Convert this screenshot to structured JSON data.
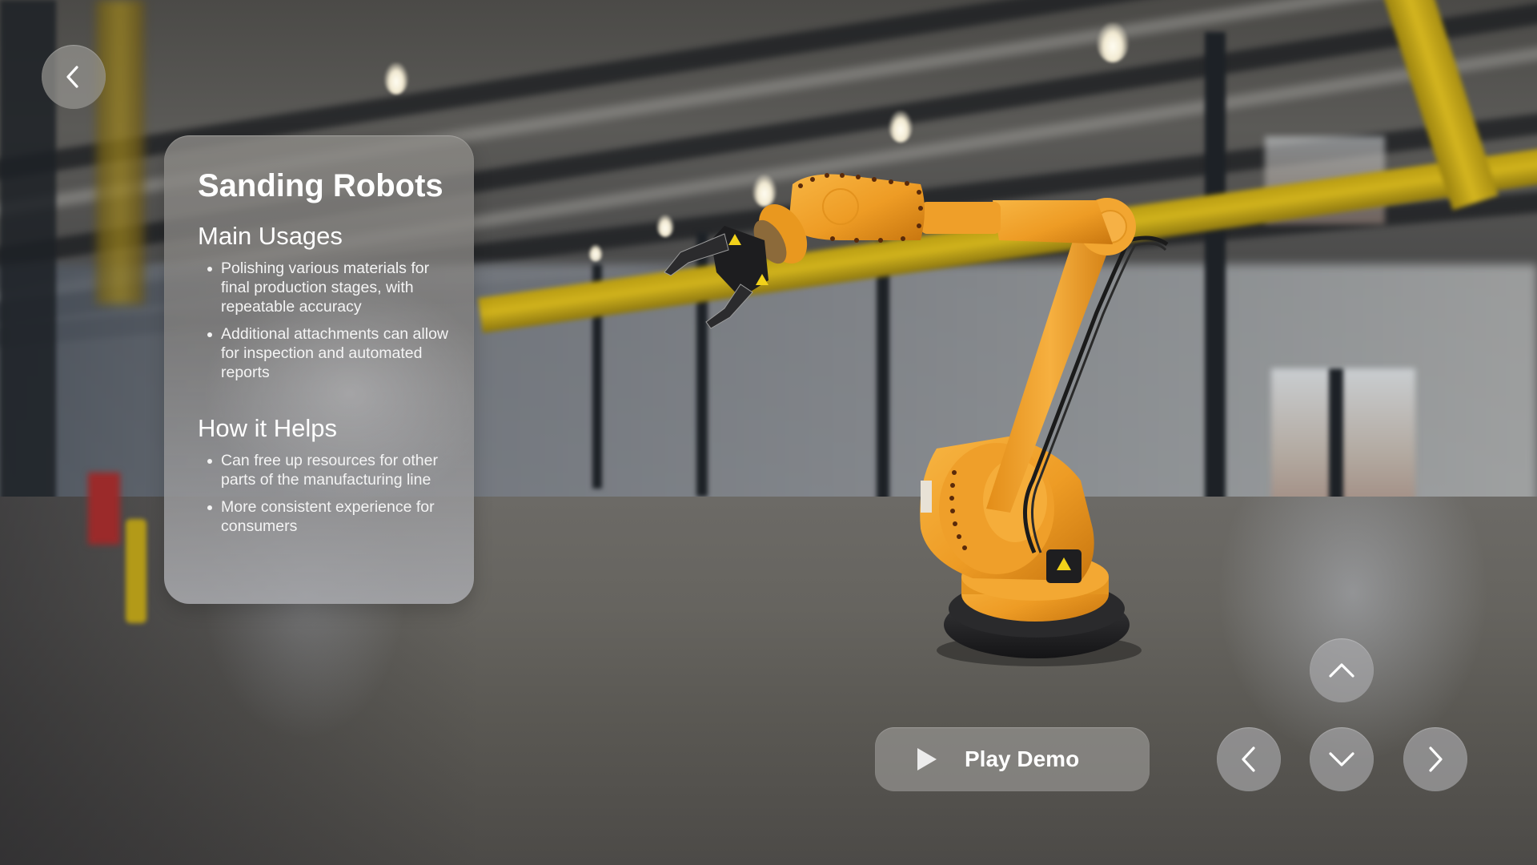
{
  "scene": {
    "subject": "industrial robotic arm in warehouse",
    "colors": {
      "robot_orange": "#f0a12a",
      "robot_orange_dark": "#c97a14",
      "robot_black": "#1c1c1e",
      "beam_yellow": "#d1b31c",
      "hazard_yellow": "#f2d21a"
    }
  },
  "navigation": {
    "back_icon": "chevron-left-icon"
  },
  "info_panel": {
    "title": "Sanding Robots",
    "sections": [
      {
        "heading": "Main Usages",
        "bullets": [
          "Polishing various materials for final production stages, with repeatable accuracy",
          "Additional attachments can allow for inspection and automated reports"
        ]
      },
      {
        "heading": "How it Helps",
        "bullets": [
          "Can free up resources for other parts of the manufacturing line",
          "More consistent experience for consumers"
        ]
      }
    ]
  },
  "controls": {
    "play_demo": {
      "label": "Play Demo",
      "icon": "play-icon"
    },
    "arrows": {
      "up": "chevron-up-icon",
      "left": "chevron-left-icon",
      "down": "chevron-down-icon",
      "right": "chevron-right-icon"
    }
  }
}
